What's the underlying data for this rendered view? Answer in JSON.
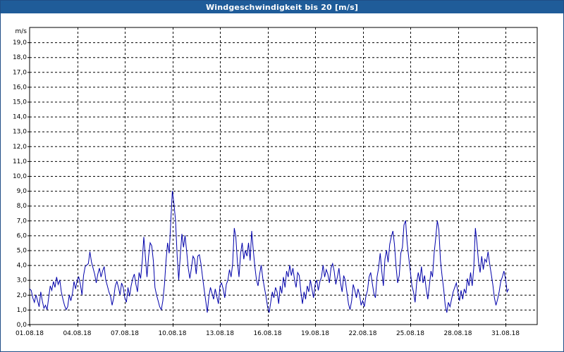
{
  "window": {
    "title": "Windgeschwindigkeit bis 20 [m/s]"
  },
  "chart_data": {
    "type": "line",
    "title": "Windgeschwindigkeit bis 20 [m/s]",
    "ylabel": "m/s",
    "xlabel": "",
    "ylim": [
      0,
      20
    ],
    "xlim_days": [
      1,
      33
    ],
    "grid": true,
    "line_color": "#0000aa",
    "y_ticks": [
      "0,0",
      "1,0",
      "2,0",
      "3,0",
      "4,0",
      "5,0",
      "6,0",
      "7,0",
      "8,0",
      "9,0",
      "10,0",
      "11,0",
      "12,0",
      "13,0",
      "14,0",
      "15,0",
      "16,0",
      "17,0",
      "18,0",
      "19,0"
    ],
    "x_ticks": [
      {
        "label": "01.08.18",
        "day": 1
      },
      {
        "label": "04.08.18",
        "day": 4
      },
      {
        "label": "07.08.18",
        "day": 7
      },
      {
        "label": "10.08.18",
        "day": 10
      },
      {
        "label": "13.08.18",
        "day": 13
      },
      {
        "label": "16.08.18",
        "day": 16
      },
      {
        "label": "19.08.18",
        "day": 19
      },
      {
        "label": "22.08.18",
        "day": 22
      },
      {
        "label": "25.08.18",
        "day": 25
      },
      {
        "label": "28.08.18",
        "day": 28
      },
      {
        "label": "31.08.18",
        "day": 31
      }
    ],
    "series": [
      {
        "values": [
          [
            1.0,
            2.4
          ],
          [
            1.1,
            2.3
          ],
          [
            1.2,
            1.8
          ],
          [
            1.3,
            1.5
          ],
          [
            1.4,
            2.0
          ],
          [
            1.5,
            1.6
          ],
          [
            1.6,
            1.2
          ],
          [
            1.7,
            2.2
          ],
          [
            1.8,
            1.6
          ],
          [
            1.9,
            1.1
          ],
          [
            2.0,
            1.3
          ],
          [
            2.1,
            1.0
          ],
          [
            2.2,
            1.8
          ],
          [
            2.3,
            2.6
          ],
          [
            2.4,
            2.3
          ],
          [
            2.5,
            2.9
          ],
          [
            2.6,
            2.5
          ],
          [
            2.7,
            3.2
          ],
          [
            2.8,
            2.7
          ],
          [
            2.9,
            3.0
          ],
          [
            3.0,
            2.2
          ],
          [
            3.1,
            1.7
          ],
          [
            3.2,
            1.3
          ],
          [
            3.3,
            1.0
          ],
          [
            3.4,
            1.2
          ],
          [
            3.5,
            2.0
          ],
          [
            3.6,
            1.6
          ],
          [
            3.7,
            2.1
          ],
          [
            3.8,
            2.9
          ],
          [
            3.9,
            2.4
          ],
          [
            4.0,
            3.0
          ],
          [
            4.1,
            3.2
          ],
          [
            4.2,
            2.7
          ],
          [
            4.3,
            2.0
          ],
          [
            4.4,
            3.3
          ],
          [
            4.5,
            3.9
          ],
          [
            4.6,
            4.0
          ],
          [
            4.7,
            4.1
          ],
          [
            4.8,
            4.9
          ],
          [
            4.9,
            4.2
          ],
          [
            5.0,
            3.8
          ],
          [
            5.1,
            3.4
          ],
          [
            5.2,
            2.8
          ],
          [
            5.3,
            3.4
          ],
          [
            5.4,
            3.8
          ],
          [
            5.5,
            3.2
          ],
          [
            5.6,
            3.6
          ],
          [
            5.7,
            3.9
          ],
          [
            5.8,
            3.0
          ],
          [
            5.9,
            2.6
          ],
          [
            6.0,
            2.2
          ],
          [
            6.1,
            1.9
          ],
          [
            6.2,
            1.3
          ],
          [
            6.3,
            1.8
          ],
          [
            6.4,
            2.6
          ],
          [
            6.5,
            2.9
          ],
          [
            6.6,
            2.5
          ],
          [
            6.7,
            2.0
          ],
          [
            6.8,
            2.8
          ],
          [
            6.9,
            2.5
          ],
          [
            7.0,
            1.8
          ],
          [
            7.1,
            1.5
          ],
          [
            7.2,
            2.5
          ],
          [
            7.3,
            1.9
          ],
          [
            7.4,
            2.6
          ],
          [
            7.5,
            3.1
          ],
          [
            7.6,
            3.4
          ],
          [
            7.7,
            2.7
          ],
          [
            7.8,
            2.2
          ],
          [
            7.9,
            3.5
          ],
          [
            8.0,
            3.1
          ],
          [
            8.1,
            4.3
          ],
          [
            8.2,
            5.9
          ],
          [
            8.3,
            4.5
          ],
          [
            8.4,
            3.2
          ],
          [
            8.5,
            4.6
          ],
          [
            8.6,
            5.5
          ],
          [
            8.7,
            5.3
          ],
          [
            8.8,
            4.3
          ],
          [
            8.9,
            2.5
          ],
          [
            9.0,
            2.0
          ],
          [
            9.1,
            1.6
          ],
          [
            9.2,
            1.2
          ],
          [
            9.3,
            1.0
          ],
          [
            9.4,
            1.6
          ],
          [
            9.5,
            2.7
          ],
          [
            9.6,
            4.3
          ],
          [
            9.7,
            5.5
          ],
          [
            9.8,
            4.8
          ],
          [
            9.9,
            7.0
          ],
          [
            10.0,
            9.0
          ],
          [
            10.1,
            8.1
          ],
          [
            10.2,
            7.0
          ],
          [
            10.3,
            4.6
          ],
          [
            10.4,
            3.0
          ],
          [
            10.5,
            4.7
          ],
          [
            10.6,
            6.1
          ],
          [
            10.7,
            5.2
          ],
          [
            10.8,
            6.0
          ],
          [
            10.9,
            4.9
          ],
          [
            11.0,
            3.8
          ],
          [
            11.1,
            3.1
          ],
          [
            11.2,
            3.8
          ],
          [
            11.3,
            4.6
          ],
          [
            11.4,
            4.4
          ],
          [
            11.5,
            3.4
          ],
          [
            11.6,
            4.6
          ],
          [
            11.7,
            4.7
          ],
          [
            11.8,
            4.1
          ],
          [
            11.9,
            3.2
          ],
          [
            12.0,
            2.4
          ],
          [
            12.1,
            1.6
          ],
          [
            12.2,
            0.8
          ],
          [
            12.3,
            1.9
          ],
          [
            12.4,
            2.5
          ],
          [
            12.5,
            2.1
          ],
          [
            12.6,
            1.7
          ],
          [
            12.7,
            2.4
          ],
          [
            12.8,
            1.9
          ],
          [
            12.9,
            1.4
          ],
          [
            13.0,
            2.6
          ],
          [
            13.1,
            2.8
          ],
          [
            13.2,
            2.4
          ],
          [
            13.3,
            1.8
          ],
          [
            13.4,
            2.7
          ],
          [
            13.5,
            3.0
          ],
          [
            13.6,
            3.7
          ],
          [
            13.7,
            3.2
          ],
          [
            13.8,
            4.1
          ],
          [
            13.9,
            6.5
          ],
          [
            14.0,
            5.9
          ],
          [
            14.1,
            4.2
          ],
          [
            14.2,
            3.2
          ],
          [
            14.3,
            4.8
          ],
          [
            14.4,
            5.5
          ],
          [
            14.5,
            4.4
          ],
          [
            14.6,
            5.0
          ],
          [
            14.7,
            4.6
          ],
          [
            14.8,
            5.5
          ],
          [
            14.9,
            4.3
          ],
          [
            15.0,
            6.3
          ],
          [
            15.1,
            5.0
          ],
          [
            15.2,
            3.9
          ],
          [
            15.3,
            3.0
          ],
          [
            15.4,
            2.6
          ],
          [
            15.5,
            3.4
          ],
          [
            15.6,
            4.0
          ],
          [
            15.7,
            3.1
          ],
          [
            15.8,
            2.5
          ],
          [
            15.9,
            1.9
          ],
          [
            16.0,
            1.2
          ],
          [
            16.1,
            0.8
          ],
          [
            16.2,
            1.5
          ],
          [
            16.3,
            2.2
          ],
          [
            16.4,
            1.8
          ],
          [
            16.5,
            2.5
          ],
          [
            16.6,
            2.2
          ],
          [
            16.7,
            1.4
          ],
          [
            16.8,
            2.6
          ],
          [
            16.9,
            2.1
          ],
          [
            17.0,
            3.2
          ],
          [
            17.1,
            2.5
          ],
          [
            17.2,
            3.6
          ],
          [
            17.3,
            3.2
          ],
          [
            17.4,
            4.0
          ],
          [
            17.5,
            3.3
          ],
          [
            17.6,
            3.8
          ],
          [
            17.7,
            3.0
          ],
          [
            17.8,
            2.5
          ],
          [
            17.9,
            3.5
          ],
          [
            18.0,
            3.3
          ],
          [
            18.1,
            2.2
          ],
          [
            18.2,
            1.4
          ],
          [
            18.3,
            2.2
          ],
          [
            18.4,
            1.7
          ],
          [
            18.5,
            2.6
          ],
          [
            18.6,
            2.2
          ],
          [
            18.7,
            3.0
          ],
          [
            18.8,
            2.4
          ],
          [
            18.9,
            1.8
          ],
          [
            19.0,
            2.7
          ],
          [
            19.1,
            3.0
          ],
          [
            19.2,
            2.3
          ],
          [
            19.3,
            2.9
          ],
          [
            19.4,
            3.2
          ],
          [
            19.5,
            4.0
          ],
          [
            19.6,
            3.2
          ],
          [
            19.7,
            3.7
          ],
          [
            19.8,
            3.4
          ],
          [
            19.9,
            2.8
          ],
          [
            20.0,
            3.8
          ],
          [
            20.1,
            4.1
          ],
          [
            20.2,
            3.6
          ],
          [
            20.3,
            2.7
          ],
          [
            20.4,
            3.2
          ],
          [
            20.5,
            3.8
          ],
          [
            20.6,
            2.8
          ],
          [
            20.7,
            2.2
          ],
          [
            20.8,
            3.3
          ],
          [
            20.9,
            3.0
          ],
          [
            21.0,
            2.2
          ],
          [
            21.1,
            1.4
          ],
          [
            21.2,
            1.0
          ],
          [
            21.3,
            1.6
          ],
          [
            21.4,
            2.7
          ],
          [
            21.5,
            2.3
          ],
          [
            21.6,
            1.8
          ],
          [
            21.7,
            2.4
          ],
          [
            21.8,
            2.0
          ],
          [
            21.9,
            1.3
          ],
          [
            22.0,
            1.6
          ],
          [
            22.1,
            1.2
          ],
          [
            22.2,
            1.9
          ],
          [
            22.3,
            2.3
          ],
          [
            22.4,
            3.2
          ],
          [
            22.5,
            3.5
          ],
          [
            22.6,
            2.8
          ],
          [
            22.7,
            2.1
          ],
          [
            22.8,
            1.8
          ],
          [
            22.9,
            3.2
          ],
          [
            23.0,
            3.8
          ],
          [
            23.1,
            4.8
          ],
          [
            23.2,
            3.6
          ],
          [
            23.3,
            2.6
          ],
          [
            23.4,
            4.4
          ],
          [
            23.5,
            5.0
          ],
          [
            23.6,
            4.2
          ],
          [
            23.7,
            5.4
          ],
          [
            23.8,
            5.9
          ],
          [
            23.9,
            6.3
          ],
          [
            24.0,
            5.4
          ],
          [
            24.1,
            3.9
          ],
          [
            24.2,
            2.8
          ],
          [
            24.3,
            3.3
          ],
          [
            24.4,
            4.8
          ],
          [
            24.5,
            5.2
          ],
          [
            24.6,
            6.7
          ],
          [
            24.7,
            7.0
          ],
          [
            24.8,
            5.5
          ],
          [
            24.9,
            4.5
          ],
          [
            25.0,
            3.6
          ],
          [
            25.1,
            2.6
          ],
          [
            25.2,
            2.2
          ],
          [
            25.3,
            1.5
          ],
          [
            25.4,
            2.8
          ],
          [
            25.5,
            3.5
          ],
          [
            25.6,
            2.9
          ],
          [
            25.7,
            3.9
          ],
          [
            25.8,
            2.8
          ],
          [
            25.9,
            3.3
          ],
          [
            26.0,
            2.4
          ],
          [
            26.1,
            1.7
          ],
          [
            26.2,
            2.6
          ],
          [
            26.3,
            3.6
          ],
          [
            26.4,
            3.2
          ],
          [
            26.5,
            4.8
          ],
          [
            26.6,
            5.8
          ],
          [
            26.7,
            7.0
          ],
          [
            26.8,
            6.4
          ],
          [
            26.9,
            4.3
          ],
          [
            27.0,
            3.3
          ],
          [
            27.1,
            2.4
          ],
          [
            27.2,
            1.3
          ],
          [
            27.3,
            0.8
          ],
          [
            27.4,
            1.5
          ],
          [
            27.5,
            1.2
          ],
          [
            27.6,
            1.7
          ],
          [
            27.7,
            2.2
          ],
          [
            27.8,
            2.5
          ],
          [
            27.9,
            2.8
          ],
          [
            28.0,
            2.2
          ],
          [
            28.1,
            1.6
          ],
          [
            28.2,
            2.3
          ],
          [
            28.3,
            1.7
          ],
          [
            28.4,
            2.4
          ],
          [
            28.5,
            2.1
          ],
          [
            28.6,
            3.1
          ],
          [
            28.7,
            2.6
          ],
          [
            28.8,
            3.5
          ],
          [
            28.9,
            2.6
          ],
          [
            29.0,
            3.8
          ],
          [
            29.1,
            6.5
          ],
          [
            29.2,
            5.5
          ],
          [
            29.3,
            4.2
          ],
          [
            29.4,
            3.5
          ],
          [
            29.5,
            4.6
          ],
          [
            29.6,
            3.7
          ],
          [
            29.7,
            4.4
          ],
          [
            29.8,
            4.2
          ],
          [
            29.9,
            4.9
          ],
          [
            30.0,
            4.1
          ],
          [
            30.1,
            3.4
          ],
          [
            30.2,
            2.7
          ],
          [
            30.3,
            1.8
          ],
          [
            30.4,
            1.3
          ],
          [
            30.5,
            1.7
          ],
          [
            30.6,
            2.2
          ],
          [
            30.7,
            2.9
          ],
          [
            30.8,
            3.2
          ],
          [
            30.9,
            3.6
          ],
          [
            31.0,
            3.1
          ],
          [
            31.1,
            2.2
          ],
          [
            31.2,
            2.4
          ]
        ]
      }
    ]
  }
}
